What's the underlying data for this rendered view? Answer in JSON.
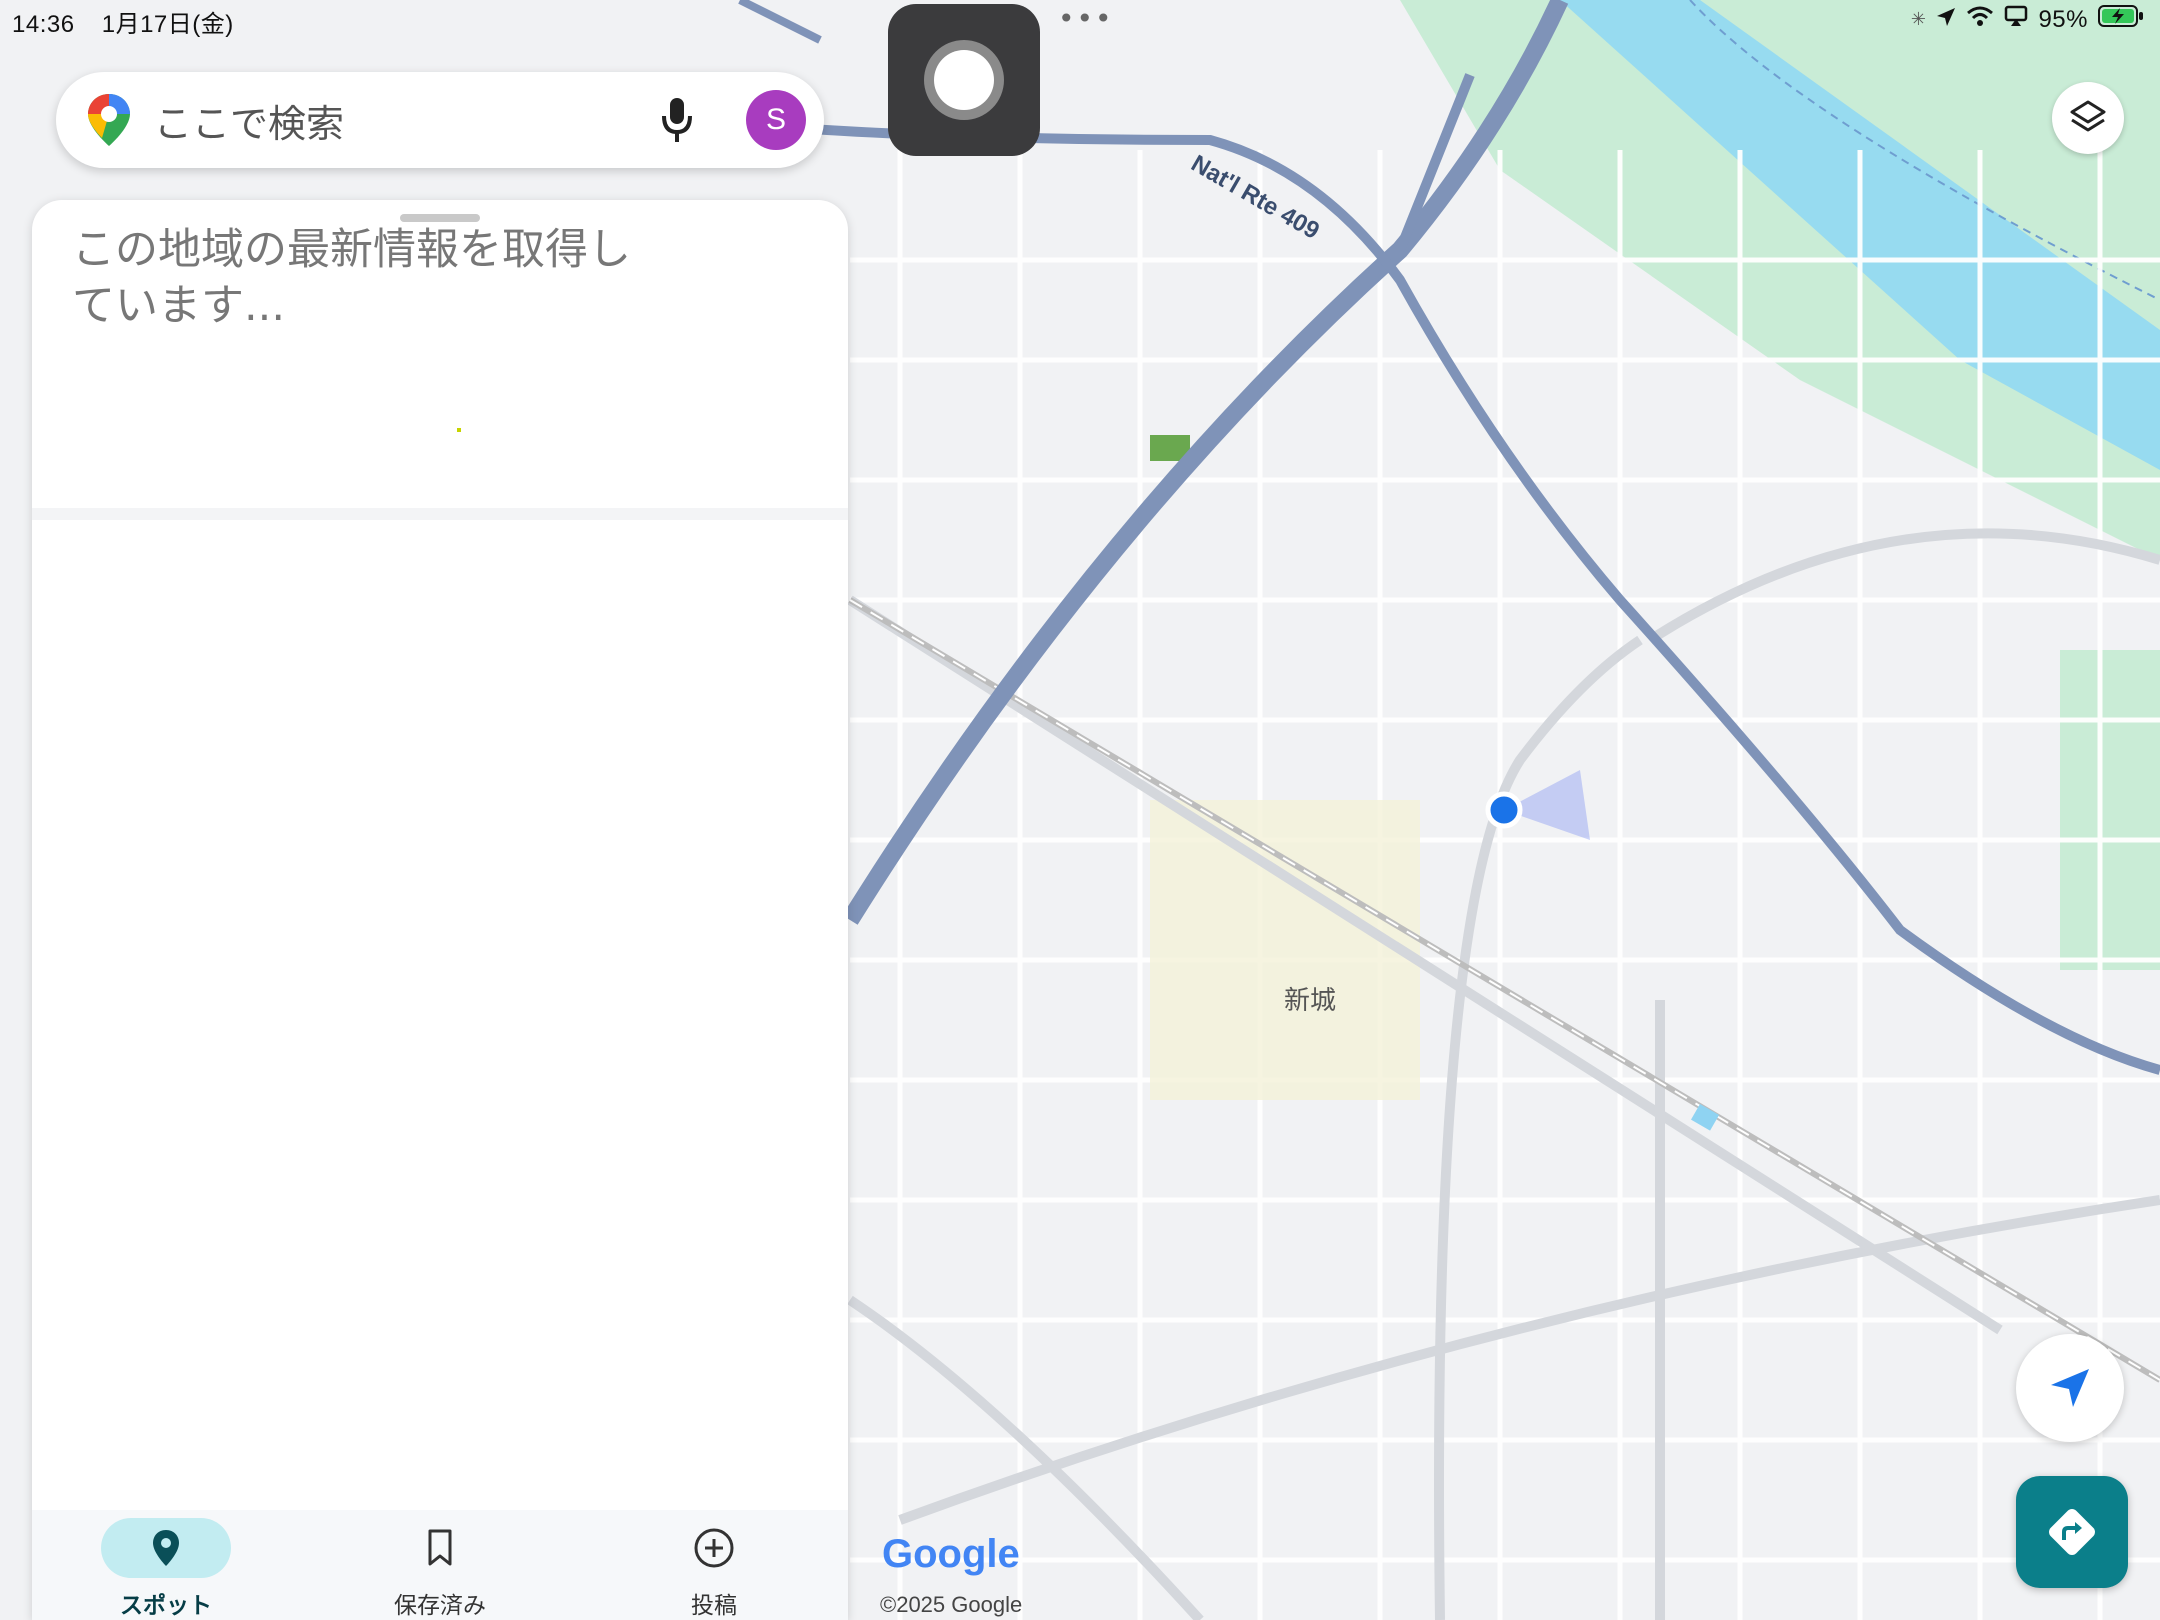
{
  "status_bar": {
    "time": "14:36",
    "date": "1月17日(金)",
    "battery": "95%",
    "icons": [
      "loading-icon",
      "location-arrow-icon",
      "wifi-icon",
      "screen-mirror-icon",
      "battery-icon"
    ]
  },
  "search": {
    "placeholder": "ここで検索",
    "avatar_letter": "S",
    "avatar_color": "#a83cbf",
    "icons": [
      "google-maps-pin-icon",
      "microphone-icon"
    ]
  },
  "panel": {
    "loading_text": "この地域の最新情報を取得しています..."
  },
  "bottom_nav": {
    "items": [
      {
        "label": "スポット",
        "icon": "location-pin-icon",
        "active": true
      },
      {
        "label": "保存済み",
        "icon": "bookmark-icon",
        "active": false
      },
      {
        "label": "投稿",
        "icon": "add-circle-icon",
        "active": false
      }
    ]
  },
  "map": {
    "route_label": "Nat'l Rte 409",
    "area_label": "新城",
    "logo": "Google",
    "copyright": "©2025 Google",
    "colors": {
      "river": "#97dbf0",
      "park": "#c9ecd6",
      "highway": "#7f93b8",
      "accent": "#0b7f8a",
      "my_location": "#1a73e8"
    }
  }
}
